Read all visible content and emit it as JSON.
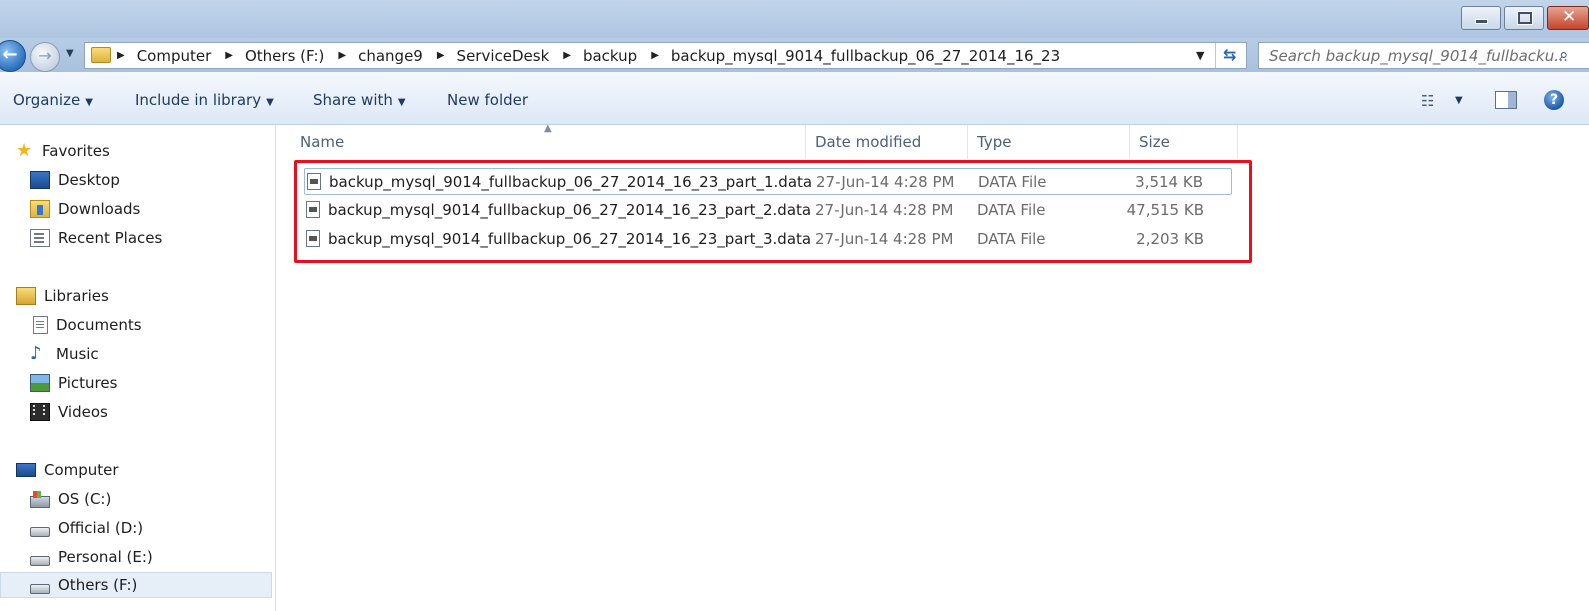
{
  "address": {
    "crumbs": [
      "Computer",
      "Others (F:)",
      "change9",
      "ServiceDesk",
      "backup",
      "backup_mysql_9014_fullbackup_06_27_2014_16_23"
    ]
  },
  "search": {
    "placeholder": "Search backup_mysql_9014_fullbacku..."
  },
  "toolbar": {
    "organize": "Organize",
    "include_in_library": "Include in library",
    "share_with": "Share with",
    "new_folder": "New folder"
  },
  "nav": {
    "favorites": "Favorites",
    "desktop": "Desktop",
    "downloads": "Downloads",
    "recent_places": "Recent Places",
    "libraries": "Libraries",
    "documents": "Documents",
    "music": "Music",
    "pictures": "Pictures",
    "videos": "Videos",
    "computer": "Computer",
    "os_c": "OS (C:)",
    "official_d": "Official (D:)",
    "personal_e": "Personal (E:)",
    "others_f": "Others (F:)"
  },
  "columns": {
    "name": "Name",
    "date_modified": "Date modified",
    "type": "Type",
    "size": "Size"
  },
  "files": [
    {
      "name": "backup_mysql_9014_fullbackup_06_27_2014_16_23_part_1.data",
      "date": "27-Jun-14 4:28 PM",
      "type": "DATA File",
      "size": "3,514 KB"
    },
    {
      "name": "backup_mysql_9014_fullbackup_06_27_2014_16_23_part_2.data",
      "date": "27-Jun-14 4:28 PM",
      "type": "DATA File",
      "size": "47,515 KB"
    },
    {
      "name": "backup_mysql_9014_fullbackup_06_27_2014_16_23_part_3.data",
      "date": "27-Jun-14 4:28 PM",
      "type": "DATA File",
      "size": "2,203 KB"
    }
  ],
  "colors": {
    "highlight": "#e8101c",
    "accent": "#1e3c66"
  }
}
